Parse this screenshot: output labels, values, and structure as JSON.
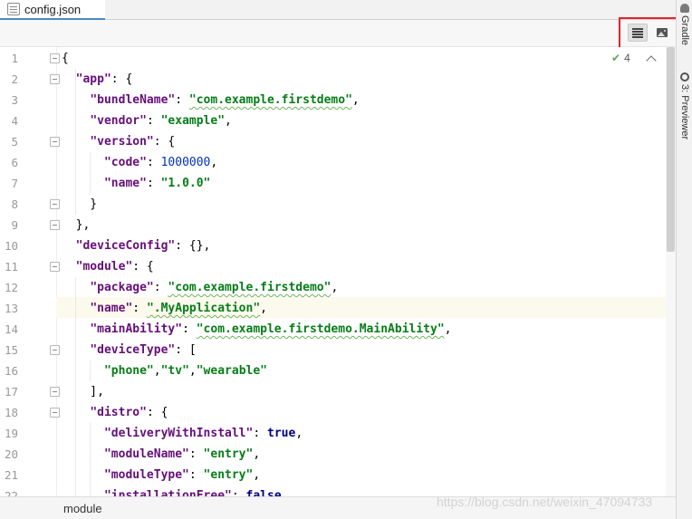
{
  "tab": {
    "file_name": "config.json"
  },
  "toolbar": {
    "text_mode_icon": "lines-icon",
    "preview_mode_icon": "image-icon"
  },
  "inspection": {
    "count": "4"
  },
  "side_panel": {
    "gradle_label": "Gradle",
    "previewer_label": "3: Previewer"
  },
  "editor": {
    "lines": [
      {
        "n": "1",
        "tokens": [
          [
            "p",
            "{"
          ]
        ]
      },
      {
        "n": "2",
        "tokens": [
          [
            "p",
            "  "
          ],
          [
            "k",
            "\"app\""
          ],
          [
            "p",
            ": {"
          ]
        ]
      },
      {
        "n": "3",
        "tokens": [
          [
            "p",
            "    "
          ],
          [
            "k",
            "\"bundleName\""
          ],
          [
            "p",
            ": "
          ],
          [
            "s",
            "\"com.example.firstdemo\""
          ],
          [
            "p",
            ","
          ]
        ]
      },
      {
        "n": "4",
        "tokens": [
          [
            "p",
            "    "
          ],
          [
            "k",
            "\"vendor\""
          ],
          [
            "p",
            ": "
          ],
          [
            "s",
            "\"example\""
          ],
          [
            "p",
            ","
          ]
        ]
      },
      {
        "n": "5",
        "tokens": [
          [
            "p",
            "    "
          ],
          [
            "k",
            "\"version\""
          ],
          [
            "p",
            ": {"
          ]
        ]
      },
      {
        "n": "6",
        "tokens": [
          [
            "p",
            "      "
          ],
          [
            "k",
            "\"code\""
          ],
          [
            "p",
            ": "
          ],
          [
            "n",
            "1000000"
          ],
          [
            "p",
            ","
          ]
        ]
      },
      {
        "n": "7",
        "tokens": [
          [
            "p",
            "      "
          ],
          [
            "k",
            "\"name\""
          ],
          [
            "p",
            ": "
          ],
          [
            "s",
            "\"1.0.0\""
          ]
        ]
      },
      {
        "n": "8",
        "tokens": [
          [
            "p",
            "    }"
          ]
        ]
      },
      {
        "n": "9",
        "tokens": [
          [
            "p",
            "  },"
          ]
        ]
      },
      {
        "n": "10",
        "tokens": [
          [
            "p",
            "  "
          ],
          [
            "k",
            "\"deviceConfig\""
          ],
          [
            "p",
            ": {},"
          ]
        ]
      },
      {
        "n": "11",
        "tokens": [
          [
            "p",
            "  "
          ],
          [
            "k",
            "\"module\""
          ],
          [
            "p",
            ": {"
          ]
        ]
      },
      {
        "n": "12",
        "tokens": [
          [
            "p",
            "    "
          ],
          [
            "k",
            "\"package\""
          ],
          [
            "p",
            ": "
          ],
          [
            "s",
            "\"com.example.firstdemo\""
          ],
          [
            "p",
            ","
          ]
        ]
      },
      {
        "n": "13",
        "tokens": [
          [
            "p",
            "    "
          ],
          [
            "k",
            "\"name\""
          ],
          [
            "p",
            ": "
          ],
          [
            "s",
            "\".MyApplication\""
          ],
          [
            "p",
            ","
          ]
        ]
      },
      {
        "n": "14",
        "tokens": [
          [
            "p",
            "    "
          ],
          [
            "k",
            "\"mainAbility\""
          ],
          [
            "p",
            ": "
          ],
          [
            "s",
            "\"com.example.firstdemo.MainAbility\""
          ],
          [
            "p",
            ","
          ]
        ]
      },
      {
        "n": "15",
        "tokens": [
          [
            "p",
            "    "
          ],
          [
            "k",
            "\"deviceType\""
          ],
          [
            "p",
            ": ["
          ]
        ]
      },
      {
        "n": "16",
        "tokens": [
          [
            "p",
            "      "
          ],
          [
            "s",
            "\"phone\""
          ],
          [
            "p",
            ","
          ],
          [
            "s",
            "\"tv\""
          ],
          [
            "p",
            ","
          ],
          [
            "s",
            "\"wearable\""
          ]
        ]
      },
      {
        "n": "17",
        "tokens": [
          [
            "p",
            "    ],"
          ]
        ]
      },
      {
        "n": "18",
        "tokens": [
          [
            "p",
            "    "
          ],
          [
            "k",
            "\"distro\""
          ],
          [
            "p",
            ": {"
          ]
        ]
      },
      {
        "n": "19",
        "tokens": [
          [
            "p",
            "      "
          ],
          [
            "k",
            "\"deliveryWithInstall\""
          ],
          [
            "p",
            ": "
          ],
          [
            "kw",
            "true"
          ],
          [
            "p",
            ","
          ]
        ]
      },
      {
        "n": "20",
        "tokens": [
          [
            "p",
            "      "
          ],
          [
            "k",
            "\"moduleName\""
          ],
          [
            "p",
            ": "
          ],
          [
            "s",
            "\"entry\""
          ],
          [
            "p",
            ","
          ]
        ]
      },
      {
        "n": "21",
        "tokens": [
          [
            "p",
            "      "
          ],
          [
            "k",
            "\"moduleType\""
          ],
          [
            "p",
            ": "
          ],
          [
            "s",
            "\"entry\""
          ],
          [
            "p",
            ","
          ]
        ]
      },
      {
        "n": "22",
        "tokens": [
          [
            "p",
            "      "
          ],
          [
            "k",
            "\"installationFree\""
          ],
          [
            "p",
            ": "
          ],
          [
            "kw",
            "false"
          ]
        ]
      }
    ]
  },
  "breadcrumb": {
    "path": "module"
  },
  "watermark": {
    "text": "https://blog.csdn.net/weixin_47094733"
  }
}
